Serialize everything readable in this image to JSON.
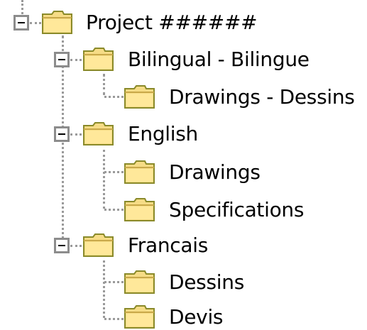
{
  "tree": {
    "root": {
      "label": "Project ######",
      "icon": "folder-closed-icon",
      "expanded": true,
      "children": [
        {
          "label": "Bilingual - Bilingue",
          "icon": "folder-closed-icon",
          "expanded": true,
          "children": [
            {
              "label": "Drawings - Dessins",
              "icon": "folder-closed-icon"
            }
          ]
        },
        {
          "label": "English",
          "icon": "folder-closed-icon",
          "expanded": true,
          "children": [
            {
              "label": "Drawings",
              "icon": "folder-closed-icon"
            },
            {
              "label": "Specifications",
              "icon": "folder-closed-icon"
            }
          ]
        },
        {
          "label": "Francais",
          "icon": "folder-closed-icon",
          "expanded": true,
          "children": [
            {
              "label": "Dessins",
              "icon": "folder-closed-icon"
            },
            {
              "label": "Devis",
              "icon": "folder-closed-icon"
            }
          ]
        }
      ]
    }
  },
  "colors": {
    "folder_fill": "#f6dc86",
    "folder_outline": "#8a8a2a",
    "connector": "#9a9a9a",
    "toggle_border": "#8c8c8c"
  }
}
